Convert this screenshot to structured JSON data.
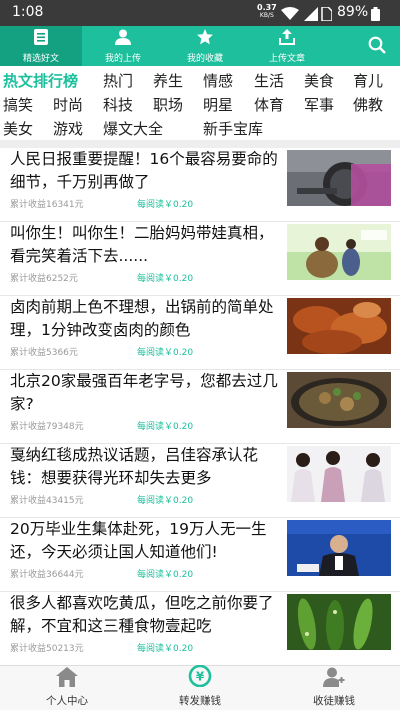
{
  "status_bar": {
    "time": "1:08",
    "net_speed": "0.37",
    "net_unit": "KB/S",
    "battery": "89%"
  },
  "top_nav": {
    "tabs": [
      {
        "label": "精选好文",
        "icon": "document-icon",
        "active": true
      },
      {
        "label": "我的上传",
        "icon": "user-icon",
        "active": false
      },
      {
        "label": "我的收藏",
        "icon": "star-icon",
        "active": false
      },
      {
        "label": "上传文章",
        "icon": "upload-icon",
        "active": false
      }
    ],
    "search_icon": "search-icon"
  },
  "categories": {
    "row1": [
      "热文排行榜",
      "热门",
      "养生",
      "情感",
      "生活",
      "美食",
      "育儿"
    ],
    "row2": [
      "搞笑",
      "时尚",
      "科技",
      "职场",
      "明星",
      "体育",
      "军事",
      "佛教"
    ],
    "row3": [
      "美女",
      "游戏",
      "爆文大全",
      "新手宝库"
    ],
    "active": "热文排行榜"
  },
  "articles": [
    {
      "title": "人民日报重要提醒！16个最容易要命的细节，千万别再做了",
      "earnings": "累计收益16341元",
      "per_read": "每阅读￥0.20"
    },
    {
      "title": "叫你生！叫你生！二胎妈妈带娃真相，看完笑着活下去......",
      "earnings": "累计收益6252元",
      "per_read": "每阅读￥0.20"
    },
    {
      "title": "卤肉前期上色不理想，出锅前的简单处理，1分钟改变卤肉的颜色",
      "earnings": "累计收益5366元",
      "per_read": "每阅读￥0.20"
    },
    {
      "title": "北京20家最强百年老字号，您都去过几家?",
      "earnings": "累计收益79348元",
      "per_read": "每阅读￥0.20"
    },
    {
      "title": "戛纳红毯成热议话题，吕佳容承认花钱：想要获得光环却失去更多",
      "earnings": "累计收益43415元",
      "per_read": "每阅读￥0.20"
    },
    {
      "title": "20万毕业生集体赴死，19万人无一生还，今天必须让国人知道他们!",
      "earnings": "累计收益36644元",
      "per_read": "每阅读￥0.20"
    },
    {
      "title": "很多人都喜欢吃黄瓜，但吃之前你要了解，不宜和这三種食物壹起吃",
      "earnings": "累计收益50213元",
      "per_read": "每阅读￥0.20"
    }
  ],
  "bottom_nav": [
    {
      "label": "个人中心",
      "icon": "home-icon"
    },
    {
      "label": "转发赚钱",
      "icon": "yuan-icon"
    },
    {
      "label": "收徒赚钱",
      "icon": "add-user-icon"
    }
  ],
  "colors": {
    "accent": "#1dbf9c",
    "accent_dark": "#13a182",
    "status_bar": "#3a3a3a"
  }
}
